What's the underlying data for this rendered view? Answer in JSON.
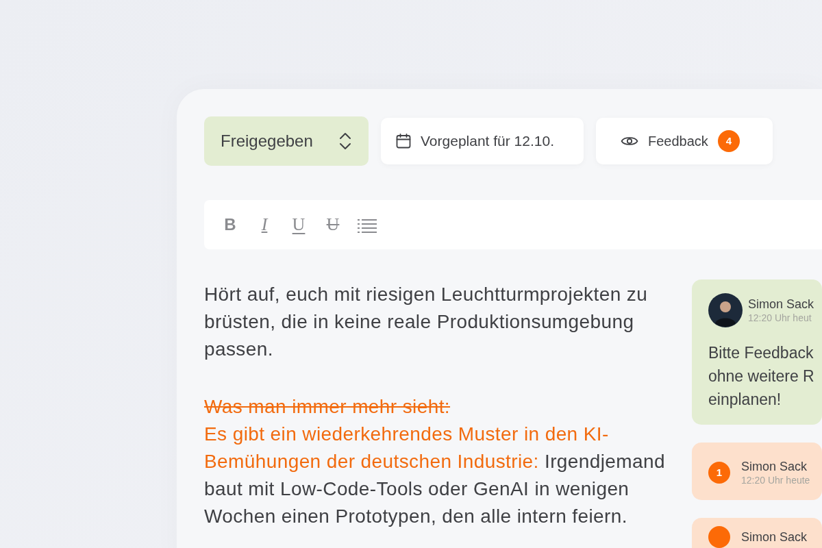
{
  "status": {
    "label": "Freigegeben"
  },
  "schedule": {
    "label": "Vorgeplant für 12.10."
  },
  "feedback": {
    "label": "Feedback",
    "count": "4"
  },
  "toolbar": [
    {
      "kind": "bold",
      "glyph": "B"
    },
    {
      "kind": "italic",
      "glyph": "I"
    },
    {
      "kind": "underline",
      "glyph": "U"
    },
    {
      "kind": "strike",
      "glyph": "U"
    },
    {
      "kind": "list"
    }
  ],
  "paragraphs": [
    {
      "segments": [
        {
          "kind": "plain",
          "text": "Hört auf, euch mit riesigen Leuchtturmprojekten zu brüsten, die in keine reale Produktionsumgebung passen."
        }
      ]
    },
    {
      "segments": [
        {
          "kind": "strike",
          "text": "Was man immer mehr sieht:"
        },
        {
          "kind": "break"
        },
        {
          "kind": "highlight",
          "text": "Es gibt ein wiederkehrendes Muster in den KI-Bemühungen der deutschen Industrie:"
        },
        {
          "kind": "plain",
          "text": " Irgendjemand baut mit Low-Code-Tools oder GenAI in wenigen Wochen einen Prototypen, den alle intern feiern."
        }
      ]
    }
  ],
  "comments": [
    {
      "kind": "note",
      "author": "Simon Sack",
      "time": "12:20 Uhr heut",
      "lines": [
        "Bitte Feedback",
        "ohne weitere R",
        "einplanen!"
      ]
    },
    {
      "kind": "feedback",
      "number": "1",
      "author": "Simon Sack",
      "time": "12:20 Uhr heute"
    },
    {
      "kind": "feedback",
      "author": "Simon Sack"
    }
  ]
}
